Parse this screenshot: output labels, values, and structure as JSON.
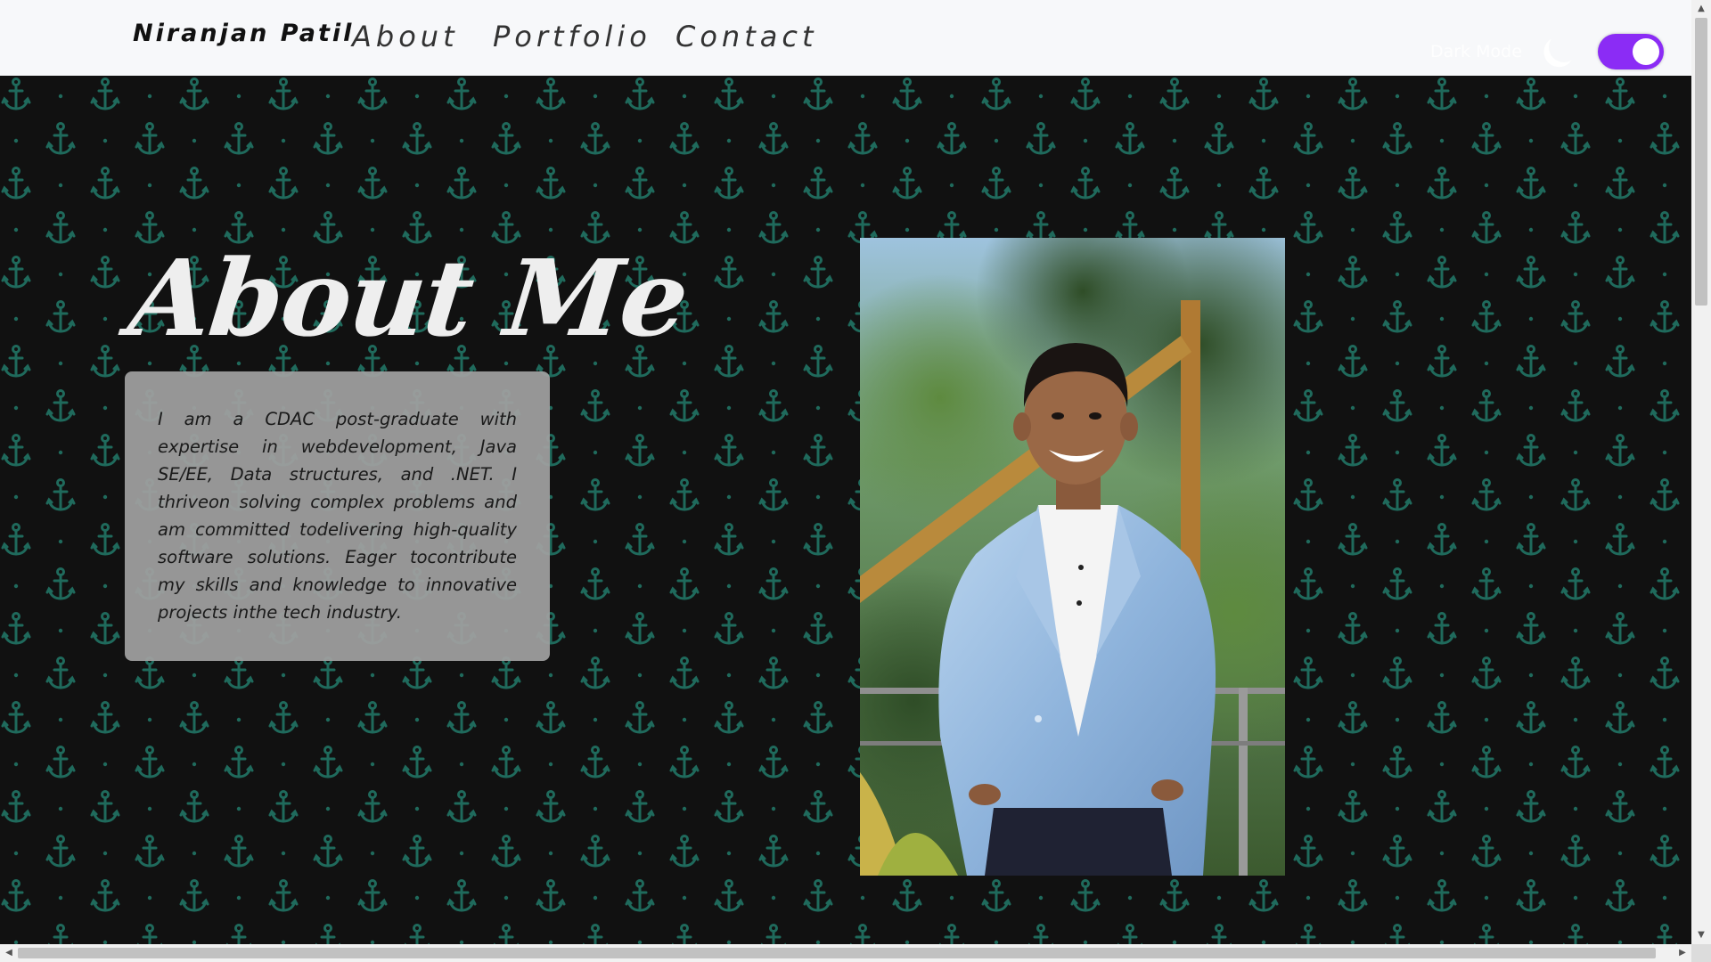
{
  "navbar": {
    "brand": "Niranjan Patil",
    "links": [
      {
        "label": "About"
      },
      {
        "label": "Portfolio"
      },
      {
        "label": "Contact"
      }
    ],
    "dark_mode_label": "Dark Mode",
    "dark_mode_on": true
  },
  "about": {
    "title": "About Me",
    "description": "I am a CDAC post-graduate with expertise in webdevelopment, Java SE/EE, Data structures, and .NET. I thriveon solving complex problems and am committed todelivering high-quality software solutions. Eager tocontribute my skills and knowledge to innovative projects inthe tech industry."
  },
  "colors": {
    "nav_background": "#f7f8fa",
    "page_background": "#111111",
    "pattern_color": "#1f6a5c",
    "toggle_accent": "#8b2cf5",
    "card_background": "#a0a0a0"
  },
  "icons": {
    "background_pattern": "anchor-icon",
    "dark_mode_icon": "moon-icon"
  }
}
